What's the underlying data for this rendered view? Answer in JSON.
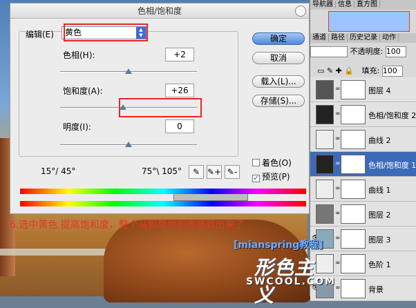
{
  "dialog": {
    "title": "色相/饱和度",
    "edit_label": "编辑(E)",
    "edit_value": "黄色",
    "hue_label": "色相(H):",
    "hue_value": "+2",
    "saturation_label": "饱和度(A):",
    "saturation_value": "+26",
    "lightness_label": "明度(I):",
    "lightness_value": "0",
    "range_left": "15°/ 45°",
    "range_right": "75°\\ 105°",
    "buttons": {
      "ok": "确定",
      "cancel": "取消",
      "load": "载入(L)...",
      "save": "存储(S)..."
    },
    "colorize_label": "着色(O)",
    "colorize_checked": false,
    "preview_label": "预览(P)",
    "preview_checked": true,
    "slider_levels": {
      "hue": 0.5,
      "saturation": 0.46,
      "lightness": 0.5
    }
  },
  "annotation": {
    "text": "6.选中黄色 提高饱和度，整个马和草地的质感就出来了"
  },
  "panel": {
    "tabs": [
      "导航器",
      "信息",
      "直方图"
    ],
    "subtabs": [
      "通道",
      "路径",
      "历史记录",
      "动作"
    ],
    "opacity_label": "不透明度:",
    "opacity_value": "100",
    "fill_label": "填充:",
    "fill_value": "100",
    "layers": [
      {
        "name": "图层 4",
        "selected": false,
        "eye": false
      },
      {
        "name": "色相/饱和度 2",
        "selected": false,
        "eye": false
      },
      {
        "name": "曲线 2",
        "selected": false,
        "eye": false
      },
      {
        "name": "色相/饱和度 1",
        "selected": true,
        "eye": false
      },
      {
        "name": "曲线 1",
        "selected": false,
        "eye": false
      },
      {
        "name": "图层 2",
        "selected": false,
        "eye": false
      },
      {
        "name": "图层 3",
        "selected": false,
        "eye": true
      },
      {
        "name": "色阶 1",
        "selected": false,
        "eye": false
      },
      {
        "name": "背景",
        "selected": false,
        "eye": true
      }
    ]
  },
  "watermark": {
    "line1": "[mianspring教程]",
    "line2": "形色主义",
    "line3": "SWCOOL.COM"
  }
}
